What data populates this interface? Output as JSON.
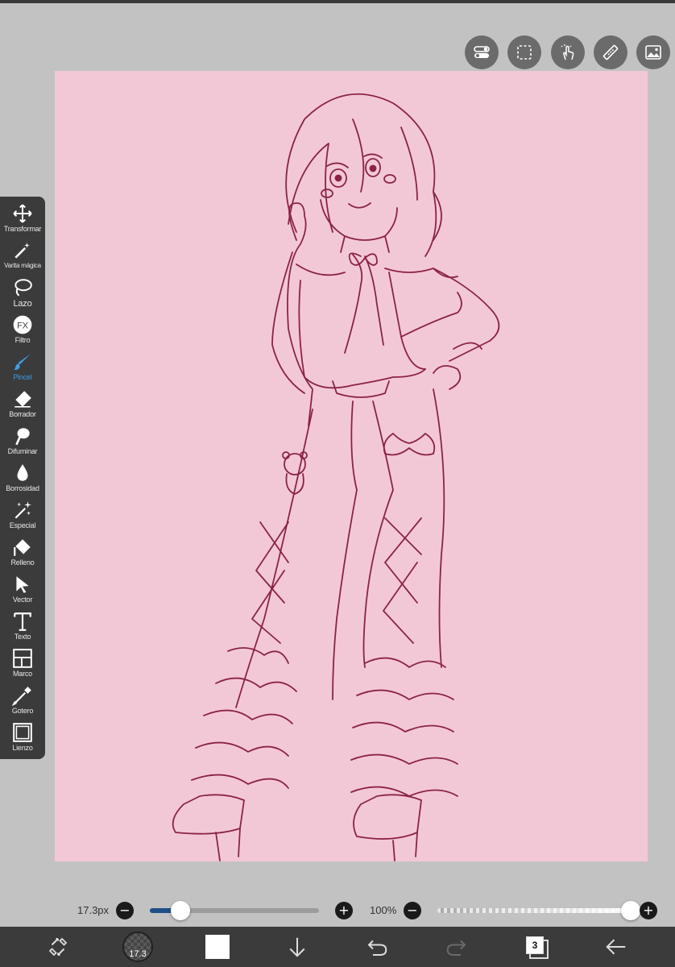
{
  "app": {
    "accent_color": "#3d9fe6",
    "canvas_color": "#f3c8d6",
    "line_color": "#8b2346"
  },
  "top_tools": [
    {
      "name": "toggle-icon"
    },
    {
      "name": "selection-icon"
    },
    {
      "name": "touch-icon"
    },
    {
      "name": "ruler-icon"
    },
    {
      "name": "image-icon"
    }
  ],
  "toolbar": {
    "items": [
      {
        "label": "Transformar",
        "icon": "move-icon"
      },
      {
        "label": "Varita mágica",
        "icon": "magic-wand-icon"
      },
      {
        "label": "Lazo",
        "icon": "lasso-icon"
      },
      {
        "label": "Filtro",
        "icon": "fx-icon"
      },
      {
        "label": "Pincel",
        "icon": "brush-icon",
        "active": true
      },
      {
        "label": "Borrador",
        "icon": "eraser-icon"
      },
      {
        "label": "Difuminar",
        "icon": "blur-icon"
      },
      {
        "label": "Borrosidad",
        "icon": "drop-icon"
      },
      {
        "label": "Especial",
        "icon": "sparkle-icon"
      },
      {
        "label": "Relleno",
        "icon": "fill-icon"
      },
      {
        "label": "Vector",
        "icon": "cursor-icon"
      },
      {
        "label": "Texto",
        "icon": "text-icon"
      },
      {
        "label": "Marco",
        "icon": "frame-icon"
      },
      {
        "label": "Gotero",
        "icon": "eyedropper-icon"
      },
      {
        "label": "Lienzo",
        "icon": "canvas-icon"
      }
    ]
  },
  "sliders": {
    "size_label": "17.3px",
    "size_fraction": 0.18,
    "opacity_label": "100%",
    "opacity_fraction": 1.0,
    "fx_text": "FX"
  },
  "bottom_bar": {
    "brush_size": "17.3",
    "layer_count": "3",
    "color": "#ffffff"
  }
}
